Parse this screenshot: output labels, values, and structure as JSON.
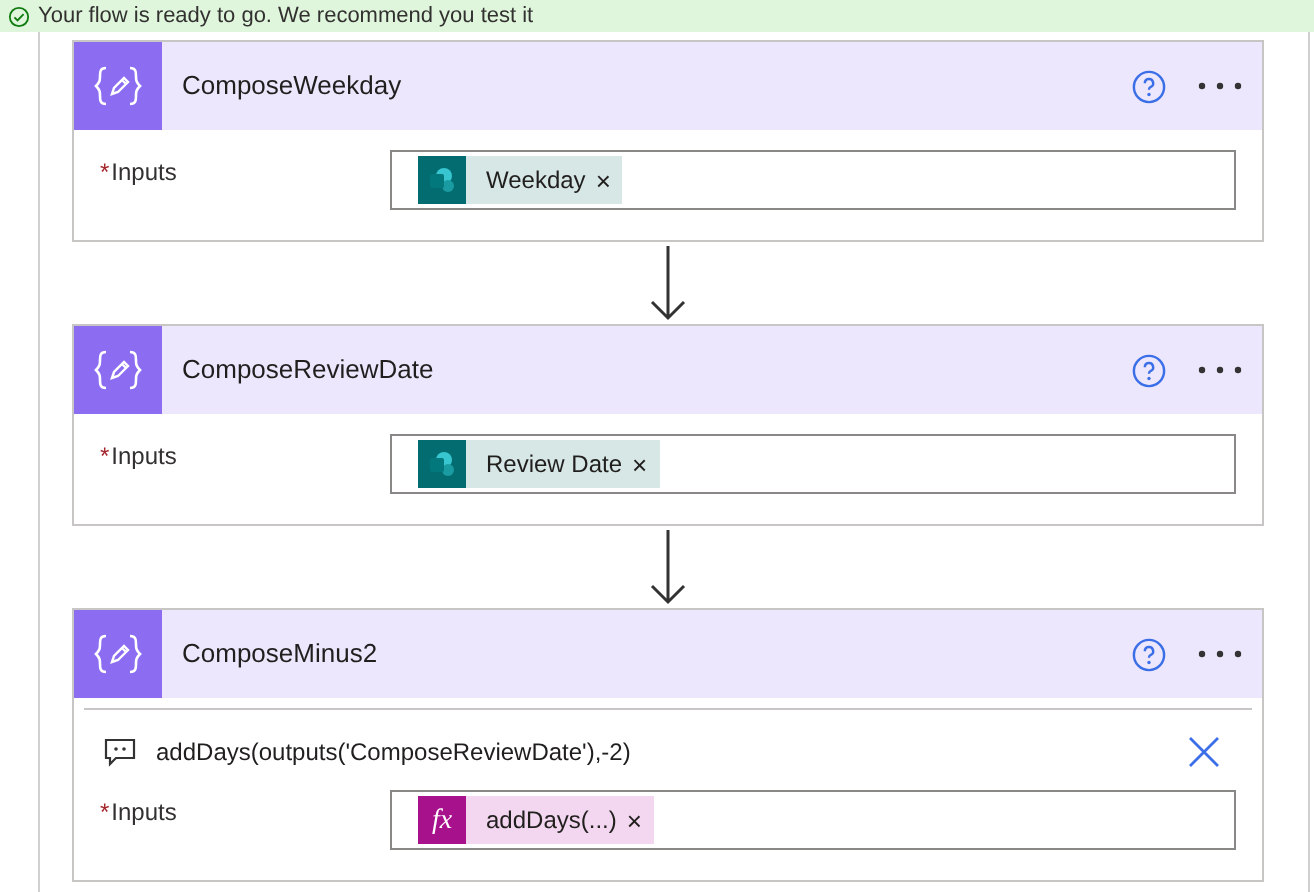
{
  "banner": {
    "text": "Your flow is ready to go. We recommend you test it"
  },
  "cards": [
    {
      "title": "ComposeWeekday",
      "field_label": "Inputs",
      "required_mark": "*",
      "tokens": [
        {
          "kind": "sharepoint",
          "label": "Weekday",
          "remove": "×"
        }
      ]
    },
    {
      "title": "ComposeReviewDate",
      "field_label": "Inputs",
      "required_mark": "*",
      "tokens": [
        {
          "kind": "sharepoint",
          "label": "Review Date",
          "remove": "×"
        }
      ]
    },
    {
      "title": "ComposeMinus2",
      "expression": "addDays(outputs('ComposeReviewDate'),-2)",
      "field_label": "Inputs",
      "required_mark": "*",
      "tokens": [
        {
          "kind": "expression",
          "label": "addDays(...)",
          "remove": "×",
          "icon_text": "fx"
        }
      ]
    }
  ]
}
